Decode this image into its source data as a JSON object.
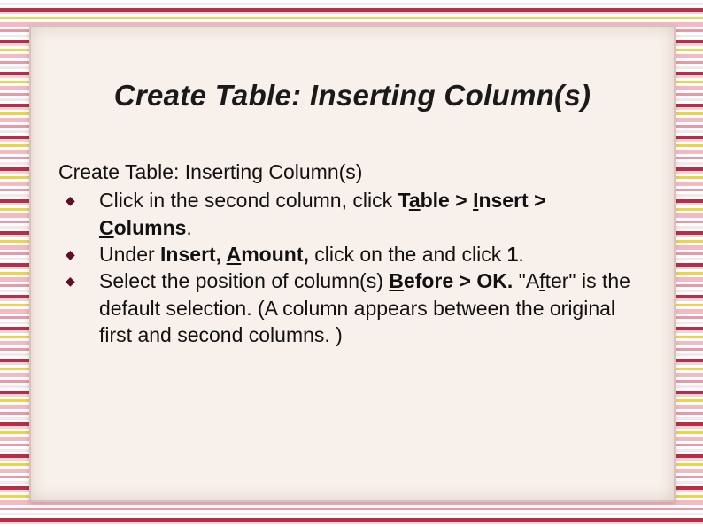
{
  "title": "Create Table: Inserting Column(s)",
  "subtitle": "Create Table: Inserting Column(s)",
  "bullets": {
    "b1": {
      "t1": "Click in the second column, click ",
      "m1_pre": "T",
      "m1_u": "a",
      "m1_post": "ble > ",
      "m2_u": "I",
      "m2_post": "nsert > ",
      "m3_u": "C",
      "m3_post": "olumns",
      "t2": "."
    },
    "b2": {
      "t1": "Under ",
      "s1": "Insert, ",
      "m1_u": "A",
      "m1_post": "mount,",
      "t2": " click on the and click ",
      "s2": "1",
      "t3": "."
    },
    "b3": {
      "t1": "Select the position of column(s) ",
      "m1_u": "B",
      "m1_post": "efore > OK.",
      "t2": " \"A",
      "m2_u": "f",
      "t3": "ter\" is the default selection. (A column appears between the original first and second columns. )"
    }
  }
}
